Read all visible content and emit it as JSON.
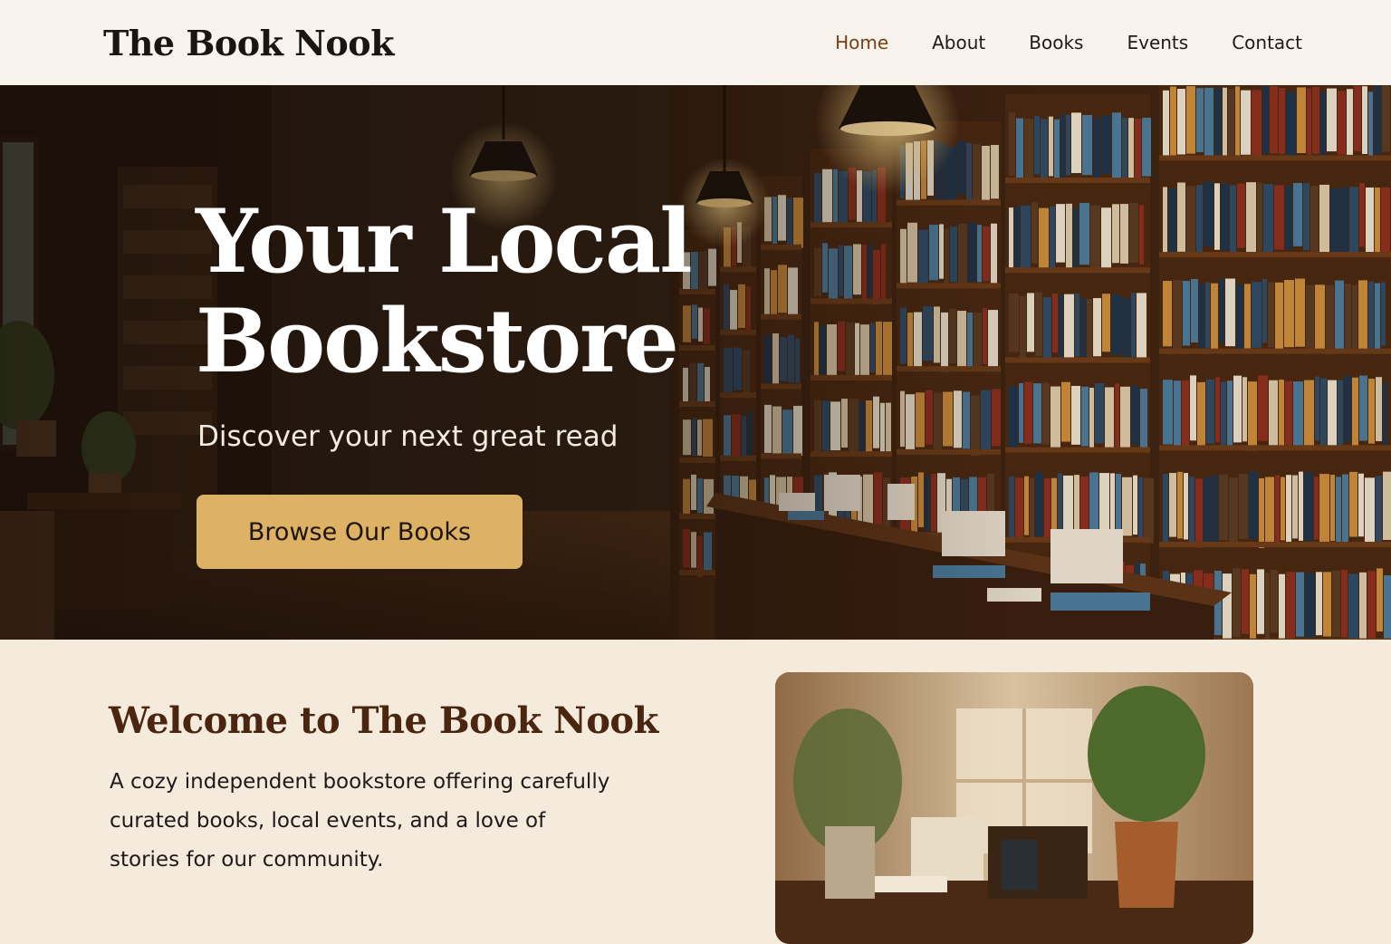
{
  "site": {
    "logo": "The Book Nook"
  },
  "nav": {
    "items": [
      {
        "label": "Home",
        "active": true
      },
      {
        "label": "About"
      },
      {
        "label": "Books"
      },
      {
        "label": "Events"
      },
      {
        "label": "Contact"
      }
    ]
  },
  "hero": {
    "title": "Your Local Bookstore",
    "subtitle": "Discover your next great read",
    "cta_label": "Browse Our Books",
    "image": "bookstore-interior-photo"
  },
  "welcome": {
    "title": "Welcome to The Book Nook",
    "body": "A cozy independent bookstore offering carefully curated books, local events, and a love of stories for our community.",
    "image": "reading-nook-photo"
  },
  "colors": {
    "accent": "#deb264",
    "nav_active": "#7a3e14",
    "heading_brown": "#4a2510",
    "background": "#f5ebdd"
  }
}
